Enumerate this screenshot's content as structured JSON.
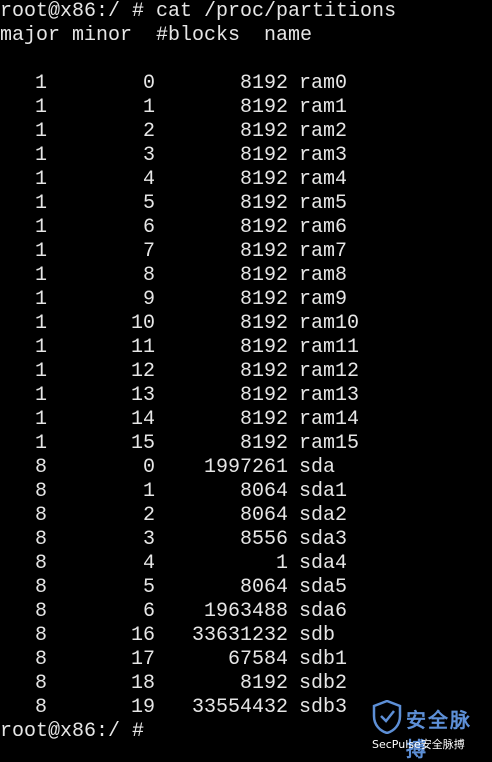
{
  "terminal": {
    "command_line": "root@x86:/ # cat /proc/partitions",
    "header": "major minor  #blocks  name",
    "rows": [
      {
        "major": "1",
        "minor": "0",
        "blocks": "8192",
        "name": "ram0"
      },
      {
        "major": "1",
        "minor": "1",
        "blocks": "8192",
        "name": "ram1"
      },
      {
        "major": "1",
        "minor": "2",
        "blocks": "8192",
        "name": "ram2"
      },
      {
        "major": "1",
        "minor": "3",
        "blocks": "8192",
        "name": "ram3"
      },
      {
        "major": "1",
        "minor": "4",
        "blocks": "8192",
        "name": "ram4"
      },
      {
        "major": "1",
        "minor": "5",
        "blocks": "8192",
        "name": "ram5"
      },
      {
        "major": "1",
        "minor": "6",
        "blocks": "8192",
        "name": "ram6"
      },
      {
        "major": "1",
        "minor": "7",
        "blocks": "8192",
        "name": "ram7"
      },
      {
        "major": "1",
        "minor": "8",
        "blocks": "8192",
        "name": "ram8"
      },
      {
        "major": "1",
        "minor": "9",
        "blocks": "8192",
        "name": "ram9"
      },
      {
        "major": "1",
        "minor": "10",
        "blocks": "8192",
        "name": "ram10"
      },
      {
        "major": "1",
        "minor": "11",
        "blocks": "8192",
        "name": "ram11"
      },
      {
        "major": "1",
        "minor": "12",
        "blocks": "8192",
        "name": "ram12"
      },
      {
        "major": "1",
        "minor": "13",
        "blocks": "8192",
        "name": "ram13"
      },
      {
        "major": "1",
        "minor": "14",
        "blocks": "8192",
        "name": "ram14"
      },
      {
        "major": "1",
        "minor": "15",
        "blocks": "8192",
        "name": "ram15"
      },
      {
        "major": "8",
        "minor": "0",
        "blocks": "1997261",
        "name": "sda"
      },
      {
        "major": "8",
        "minor": "1",
        "blocks": "8064",
        "name": "sda1"
      },
      {
        "major": "8",
        "minor": "2",
        "blocks": "8064",
        "name": "sda2"
      },
      {
        "major": "8",
        "minor": "3",
        "blocks": "8556",
        "name": "sda3"
      },
      {
        "major": "8",
        "minor": "4",
        "blocks": "1",
        "name": "sda4"
      },
      {
        "major": "8",
        "minor": "5",
        "blocks": "8064",
        "name": "sda5"
      },
      {
        "major": "8",
        "minor": "6",
        "blocks": "1963488",
        "name": "sda6"
      },
      {
        "major": "8",
        "minor": "16",
        "blocks": "33631232",
        "name": "sdb"
      },
      {
        "major": "8",
        "minor": "17",
        "blocks": "67584",
        "name": "sdb1"
      },
      {
        "major": "8",
        "minor": "18",
        "blocks": "8192",
        "name": "sdb2"
      },
      {
        "major": "8",
        "minor": "19",
        "blocks": "33554432",
        "name": "sdb3"
      }
    ],
    "final_prompt": "root@x86:/ #"
  },
  "watermark": {
    "title": "安全脉搏",
    "subtitle": "SecPulse安全脉搏",
    "icon": "shield-icon",
    "color": "#5d8fd6"
  },
  "colors": {
    "background": "#000000",
    "text": "#e6e6e6"
  }
}
